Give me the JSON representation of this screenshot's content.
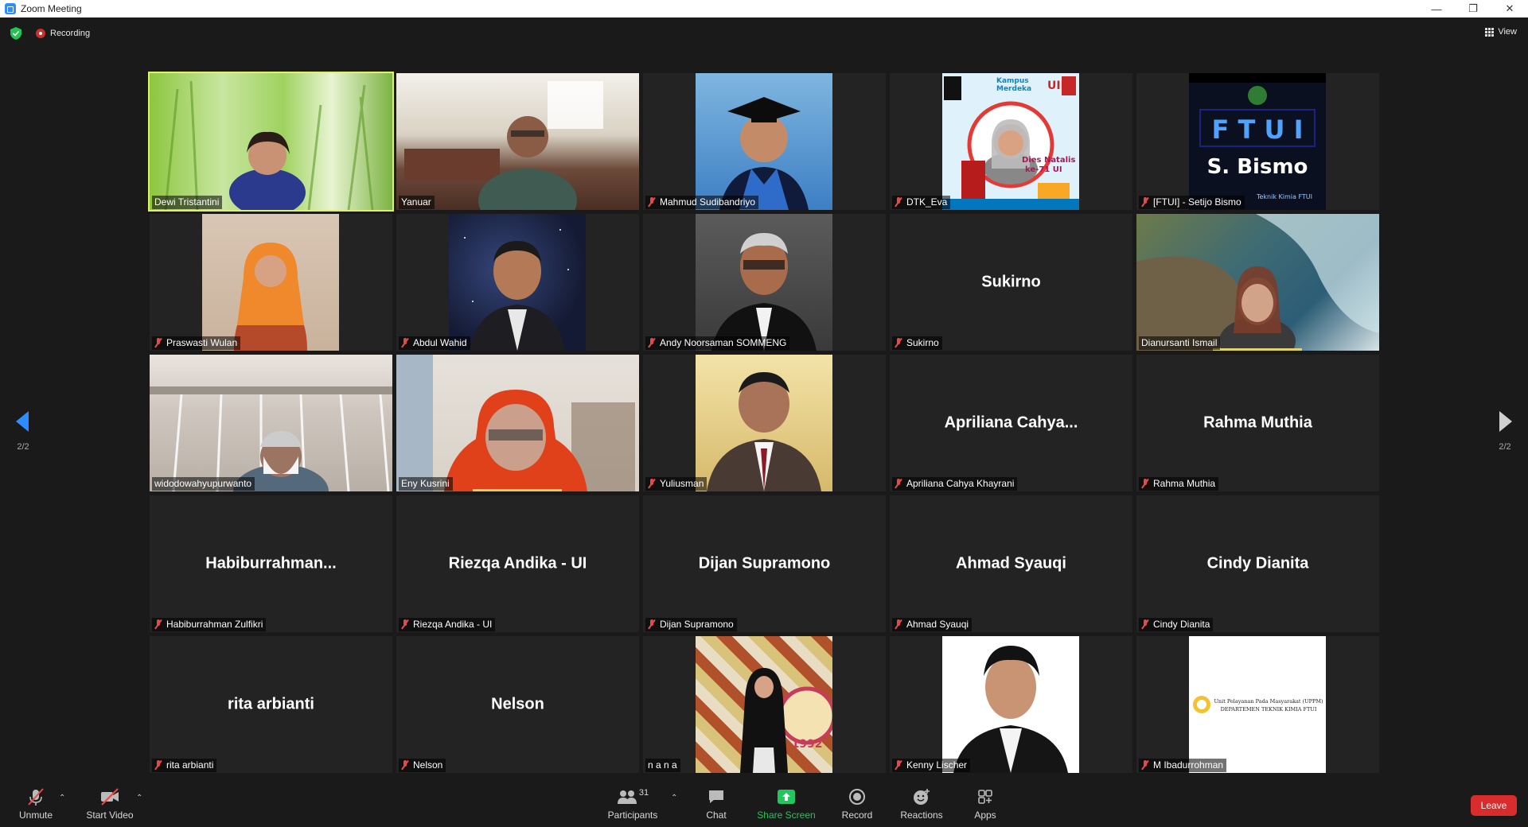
{
  "window": {
    "title": "Zoom Meeting"
  },
  "topbar": {
    "recording_label": "Recording",
    "view_label": "View"
  },
  "pager": {
    "left": "2/2",
    "right": "2/2"
  },
  "tiles": [
    {
      "name": "Dewi Tristantini",
      "center": "",
      "muted": false
    },
    {
      "name": "Yanuar",
      "center": "",
      "muted": false
    },
    {
      "name": "Mahmud Sudibandriyo",
      "center": "",
      "muted": true
    },
    {
      "name": "DTK_Eva",
      "center": "",
      "muted": true
    },
    {
      "name": "[FTUI] - Setijo Bismo",
      "center": "",
      "muted": true
    },
    {
      "name": "Praswasti Wulan",
      "center": "",
      "muted": true
    },
    {
      "name": "Abdul Wahid",
      "center": "",
      "muted": true
    },
    {
      "name": "Andy Noorsaman SOMMENG",
      "center": "",
      "muted": true
    },
    {
      "name": "Sukirno",
      "center": "Sukirno",
      "muted": true
    },
    {
      "name": "Dianursanti Ismail",
      "center": "",
      "muted": false
    },
    {
      "name": "widodowahyupurwanto",
      "center": "",
      "muted": false
    },
    {
      "name": "Eny Kusrini",
      "center": "",
      "muted": false
    },
    {
      "name": "Yuliusman",
      "center": "",
      "muted": true
    },
    {
      "name": "Apriliana Cahya Khayrani",
      "center": "Apriliana  Cahya...",
      "muted": true
    },
    {
      "name": "Rahma Muthia",
      "center": "Rahma Muthia",
      "muted": true
    },
    {
      "name": "Habiburrahman Zulfikri",
      "center": "Habiburrahman...",
      "muted": true
    },
    {
      "name": "Riezqa Andika - UI",
      "center": "Riezqa Andika - UI",
      "muted": true
    },
    {
      "name": "Dijan Supramono",
      "center": "Dijan Supramono",
      "muted": true
    },
    {
      "name": "Ahmad Syauqi",
      "center": "Ahmad Syauqi",
      "muted": true
    },
    {
      "name": "Cindy Dianita",
      "center": "Cindy Dianita",
      "muted": true
    },
    {
      "name": "rita arbianti",
      "center": "rita arbianti",
      "muted": true
    },
    {
      "name": "Nelson",
      "center": "Nelson",
      "muted": true
    },
    {
      "name": "n a n a",
      "center": "",
      "muted": false
    },
    {
      "name": "Kenny Lischer",
      "center": "",
      "muted": true
    },
    {
      "name": "M Ibadurrohman",
      "center": "",
      "muted": true
    }
  ],
  "tile_text": {
    "ftui_logo": "F T U I",
    "ftui_name": "S. Bismo",
    "ftui_sub": "Teknik Kimia FTUI",
    "dies_1": "Kampus",
    "dies_2": "Merdeka",
    "dies_3": "Dies Natalis",
    "dies_4": "ke-71 UI",
    "dies_5": "UI",
    "cpm_1": "Unit Pelayanan Pada Masyarakat (UPPM)",
    "cpm_2": "DEPARTEMEN TEKNIK KIMIA FTUI",
    "nana_year": "1992"
  },
  "toolbar": {
    "unmute": "Unmute",
    "start_video": "Start Video",
    "participants": "Participants",
    "participants_count": "31",
    "chat": "Chat",
    "share_screen": "Share Screen",
    "record": "Record",
    "reactions": "Reactions",
    "apps": "Apps",
    "leave": "Leave"
  }
}
